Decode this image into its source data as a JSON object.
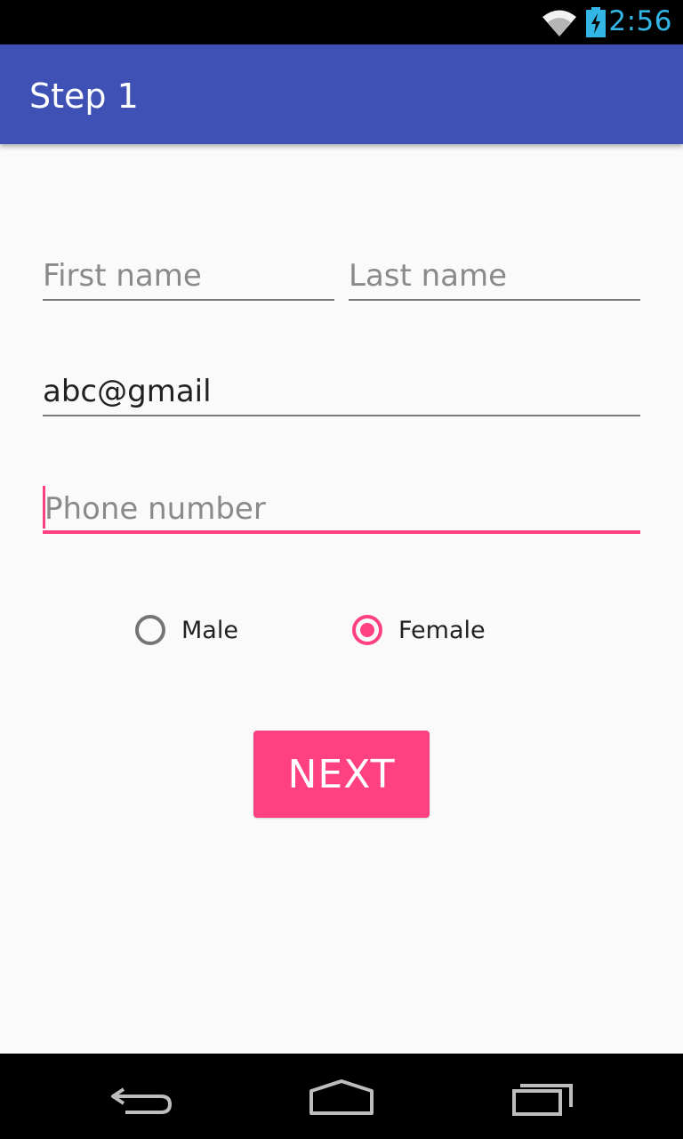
{
  "status_bar": {
    "time": "2:56",
    "icons": [
      "wifi-icon",
      "battery-charging-icon"
    ]
  },
  "app_bar": {
    "title": "Step 1"
  },
  "form": {
    "first_name": {
      "value": "",
      "placeholder": "First name"
    },
    "last_name": {
      "value": "",
      "placeholder": "Last name"
    },
    "email": {
      "value": "abc@gmail",
      "placeholder": ""
    },
    "phone": {
      "value": "",
      "placeholder": "Phone number"
    },
    "gender": {
      "options": [
        {
          "label": "Male",
          "selected": false
        },
        {
          "label": "Female",
          "selected": true
        }
      ]
    },
    "next_label": "NEXT"
  },
  "nav_bar": {
    "icons": [
      "back-icon",
      "home-icon",
      "recents-icon"
    ]
  },
  "colors": {
    "primary": "#3f51b5",
    "accent": "#ff4081",
    "status_accent": "#33b5e5"
  }
}
